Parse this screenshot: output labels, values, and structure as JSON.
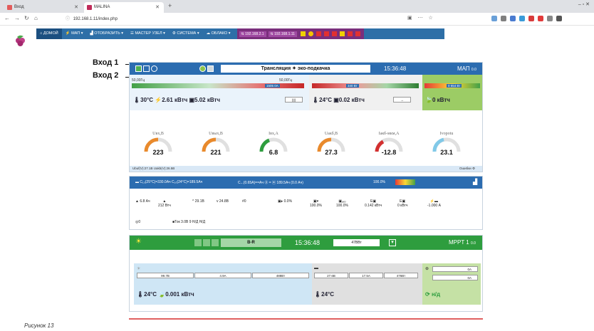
{
  "browser": {
    "tab1_title": "Вход",
    "tab2_title": "MALINA",
    "url_prefix": "ⓘ",
    "url": "192.168.1.11/index.php",
    "win_controls": "–  ▫  ✕"
  },
  "menu": {
    "home": "ДОМОЙ",
    "items": [
      "МАП ▾",
      "ОТОБРАЗИТЬ ▾",
      "МАСТЕР УЗЕЛ ▾",
      "СИСТЕМА ▾",
      "ОБЛАКО ▾"
    ],
    "ip1": "192.168.2.1",
    "ip2": "192.168.1.11"
  },
  "annotations": {
    "input1": "Вход 1",
    "input2": "Вход 2"
  },
  "card1": {
    "title": "Трансляция ✦ эко-подкачка",
    "time": "15:36:48",
    "device": "МАП",
    "device_sub": "0.0",
    "bar1_left": "50,00Гц",
    "bar1_right": "50,00Гц",
    "bar1_value": "1505 0А",
    "bar2_value": "340 Вт",
    "bar3_value": "0 654 Вт",
    "energy_left": "30°С",
    "energy_mid": "2.61 кВтч",
    "energy_right": "5.02 кВтч",
    "energy_center": "24°С",
    "energy_center2": "0.02 кВтч",
    "energy_green": "0 кВтч",
    "gauges": [
      {
        "label": "Uвх,В",
        "value": "223"
      },
      {
        "label": "Uвых,В",
        "value": "221"
      },
      {
        "label": "Iвх,А",
        "value": "6.8"
      },
      {
        "label": "Uакб,В",
        "value": "27.3"
      },
      {
        "label": "Iакб-мкм,А",
        "value": "-12.8"
      },
      {
        "label": "Ivopotu",
        "value": "23.1"
      }
    ],
    "strip_text": "Ubuf(V):27.1В  Uakb(V):26.5В",
    "strip_right": "Ошибки"
  },
  "card2": {
    "head_text": "C₁₀(25°C)=330.0Ач  C₁₀(24°C)=189.5Ач",
    "head_mid": "C...(0.65А)==Ач  ⓪  =  ▣  189.5Ач (0.0 Ач)",
    "head_pct": "100.0%",
    "row1": [
      "6.8 Ач",
      "212 Втч",
      "29.1В",
      "24.8В",
      "0",
      "0.0%",
      "100.0%",
      "100.0%",
      "0.142 кВтч",
      "0 кВтч",
      "-1.000 А"
    ],
    "row2_a": "0",
    "row2_b": "Ток 3.0В 9 Н/Д",
    "row2_c": "Н/Д"
  },
  "card3": {
    "mode": "B-R",
    "time": "15:36:48",
    "field_value": "47ВВт",
    "device": "MPPT 1",
    "device_sub": "0.0",
    "left_values": [
      "99.7В",
      "4.9А",
      "488Вт"
    ],
    "mid_values": [
      "27.6В",
      "17.5А",
      "476Вт"
    ],
    "right_values": [
      "0А",
      "0А"
    ],
    "left_energy_temp": "24°С",
    "left_energy": "0.001 кВтч",
    "mid_temp": "24°С",
    "right_nd": "н/д"
  },
  "footer": {
    "caption": "Рисунок 13"
  },
  "colors": {
    "menu_blue": "#2e6fa7",
    "header_blue": "#2b6cb0",
    "header_green": "#2e9d3e",
    "ip_purple": "#7a2f7c"
  }
}
